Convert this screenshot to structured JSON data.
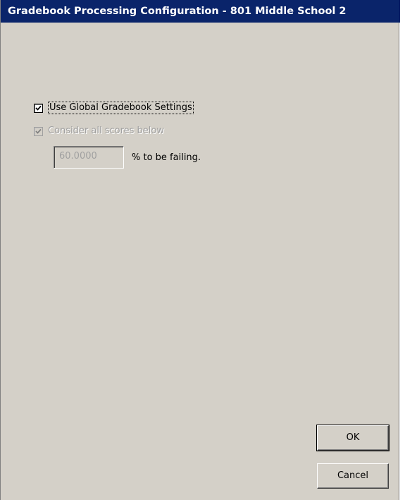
{
  "window": {
    "title": "Gradebook Processing Configuration - 801 Middle School 2"
  },
  "options": {
    "use_global": {
      "label": "Use Global Gradebook Settings",
      "checked": true
    },
    "consider_scores": {
      "label": "Consider all scores below",
      "checked": true,
      "enabled": false
    },
    "threshold": {
      "value": "60.0000",
      "suffix": "% to be failing."
    }
  },
  "buttons": {
    "ok_label": "OK",
    "cancel_label": "Cancel"
  },
  "colors": {
    "titlebar": "#0a246a",
    "dialog_face": "#d4d0c8",
    "disabled_text": "#a0a0a0"
  }
}
